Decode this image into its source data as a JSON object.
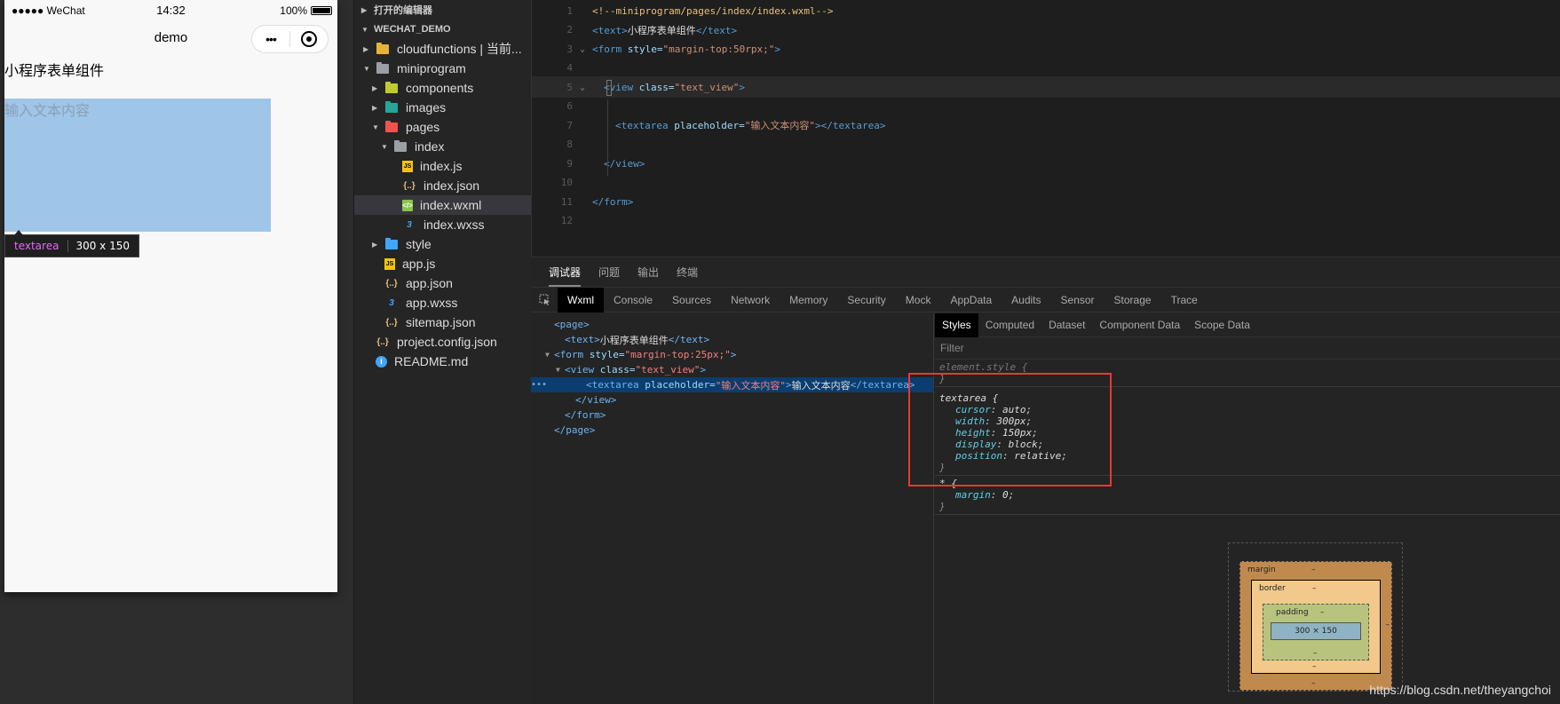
{
  "simulator": {
    "status": {
      "carrier": "●●●●● WeChat",
      "time": "14:32",
      "battery": "100%"
    },
    "nav_title": "demo",
    "capsule_more": "•••",
    "page_text": "小程序表单组件",
    "textarea_placeholder": "输入文本内容",
    "tooltip": {
      "tag": "textarea",
      "size": "300 x 150"
    }
  },
  "explorer": {
    "open_editors": "打开的编辑器",
    "project": "WECHAT_DEMO",
    "tree": [
      {
        "label": "cloudfunctions | 当前...",
        "depth": 1,
        "kind": "folder",
        "color": "#e5b33a",
        "tri": "▶"
      },
      {
        "label": "miniprogram",
        "depth": 1,
        "kind": "folder",
        "color": "#9aa0a6",
        "tri": "▼"
      },
      {
        "label": "components",
        "depth": 2,
        "kind": "folder",
        "color": "#c0ca33",
        "tri": "▶"
      },
      {
        "label": "images",
        "depth": 2,
        "kind": "folder",
        "color": "#26a69a",
        "tri": "▶"
      },
      {
        "label": "pages",
        "depth": 2,
        "kind": "folder",
        "color": "#ef5350",
        "tri": "▼"
      },
      {
        "label": "index",
        "depth": 3,
        "kind": "folder",
        "color": "#9aa0a6",
        "tri": "▼"
      },
      {
        "label": "index.js",
        "depth": 4,
        "kind": "js"
      },
      {
        "label": "index.json",
        "depth": 4,
        "kind": "json"
      },
      {
        "label": "index.wxml",
        "depth": 4,
        "kind": "wxml",
        "selected": true
      },
      {
        "label": "index.wxss",
        "depth": 4,
        "kind": "css"
      },
      {
        "label": "style",
        "depth": 2,
        "kind": "folder",
        "color": "#42a5f5",
        "tri": "▶"
      },
      {
        "label": "app.js",
        "depth": 2,
        "kind": "js"
      },
      {
        "label": "app.json",
        "depth": 2,
        "kind": "json"
      },
      {
        "label": "app.wxss",
        "depth": 2,
        "kind": "css"
      },
      {
        "label": "sitemap.json",
        "depth": 2,
        "kind": "json"
      },
      {
        "label": "project.config.json",
        "depth": 1,
        "kind": "json"
      },
      {
        "label": "README.md",
        "depth": 1,
        "kind": "info"
      }
    ]
  },
  "editor": {
    "lines": [
      {
        "n": "1",
        "fold": "",
        "indent": 0,
        "parts": [
          [
            "cm",
            "<!--miniprogram/pages/index/index.wxml-->"
          ]
        ]
      },
      {
        "n": "2",
        "fold": "",
        "indent": 0,
        "parts": [
          [
            "tg",
            "<text>"
          ],
          [
            "tx",
            "小程序表单组件"
          ],
          [
            "tg",
            "</text>"
          ]
        ]
      },
      {
        "n": "3",
        "fold": "⌄",
        "indent": 0,
        "parts": [
          [
            "tg",
            "<form "
          ],
          [
            "at",
            "style="
          ],
          [
            "st",
            "\"margin-top:50rpx;\""
          ],
          [
            "tg",
            ">"
          ]
        ]
      },
      {
        "n": "4",
        "fold": "",
        "indent": 0,
        "parts": []
      },
      {
        "n": "5",
        "fold": "⌄",
        "indent": 1,
        "hl": true,
        "parts": [
          [
            "tg",
            "<view "
          ],
          [
            "at",
            "class="
          ],
          [
            "st",
            "\"text_view\""
          ],
          [
            "tg",
            ">"
          ]
        ]
      },
      {
        "n": "6",
        "fold": "",
        "indent": 0,
        "parts": []
      },
      {
        "n": "7",
        "fold": "",
        "indent": 2,
        "parts": [
          [
            "tg",
            "<textarea "
          ],
          [
            "at",
            "placeholder="
          ],
          [
            "st",
            "\"输入文本内容\""
          ],
          [
            "tg",
            "></textarea>"
          ]
        ]
      },
      {
        "n": "8",
        "fold": "",
        "indent": 0,
        "parts": []
      },
      {
        "n": "9",
        "fold": "",
        "indent": 1,
        "parts": [
          [
            "tg",
            "</view>"
          ]
        ]
      },
      {
        "n": "10",
        "fold": "",
        "indent": 0,
        "parts": []
      },
      {
        "n": "11",
        "fold": "",
        "indent": 0,
        "parts": [
          [
            "tg",
            "</form>"
          ]
        ]
      },
      {
        "n": "12",
        "fold": "",
        "indent": 0,
        "parts": []
      }
    ]
  },
  "devtools": {
    "panel_tabs": [
      "调试器",
      "问题",
      "输出",
      "终端"
    ],
    "tabs": [
      "Wxml",
      "Console",
      "Sources",
      "Network",
      "Memory",
      "Security",
      "Mock",
      "AppData",
      "Audits",
      "Sensor",
      "Storage",
      "Trace"
    ],
    "wxml_lines": [
      {
        "indent": 0,
        "tri": "",
        "parts": [
          [
            "c-tag",
            "<page>"
          ]
        ]
      },
      {
        "indent": 1,
        "tri": "",
        "parts": [
          [
            "c-tag",
            "<text>"
          ],
          [
            "c-txt",
            "小程序表单组件"
          ],
          [
            "c-tag",
            "</text>"
          ]
        ]
      },
      {
        "indent": 0,
        "tri": "▼",
        "parts": [
          [
            "c-tag",
            "<form "
          ],
          [
            "c-att",
            "style="
          ],
          [
            "c-val",
            "\"margin-top:25px;\""
          ],
          [
            "c-tag",
            ">"
          ]
        ]
      },
      {
        "indent": 1,
        "tri": "▼",
        "parts": [
          [
            "c-tag",
            "<view "
          ],
          [
            "c-att",
            "class="
          ],
          [
            "c-val",
            "\"text_view\""
          ],
          [
            "c-tag",
            ">"
          ]
        ]
      },
      {
        "indent": 3,
        "tri": "",
        "sel": true,
        "parts": [
          [
            "c-tag",
            "<textarea "
          ],
          [
            "c-att",
            "placeholder="
          ],
          [
            "c-val",
            "\"输入文本内容\""
          ],
          [
            "c-tag",
            ">"
          ],
          [
            "c-txt",
            "输入文本内容"
          ],
          [
            "c-tag",
            "</textarea>"
          ]
        ]
      },
      {
        "indent": 2,
        "tri": "",
        "parts": [
          [
            "c-tag",
            "</view>"
          ]
        ]
      },
      {
        "indent": 1,
        "tri": "",
        "parts": [
          [
            "c-tag",
            "</form>"
          ]
        ]
      },
      {
        "indent": 0,
        "tri": "",
        "parts": [
          [
            "c-tag",
            "</page>"
          ]
        ]
      }
    ],
    "style_tabs": [
      "Styles",
      "Computed",
      "Dataset",
      "Component Data",
      "Scope Data"
    ],
    "filter_placeholder": "Filter",
    "rules": [
      {
        "selector": "element.style {",
        "decls": [],
        "close": "}"
      },
      {
        "selector": "textarea {",
        "decls": [
          [
            "cursor",
            "auto"
          ],
          [
            "width",
            "300px"
          ],
          [
            "height",
            "150px"
          ],
          [
            "display",
            "block"
          ],
          [
            "position",
            "relative"
          ]
        ],
        "close": "}"
      },
      {
        "selector": "* {",
        "decls": [
          [
            "margin",
            "0"
          ]
        ],
        "close": "}"
      }
    ],
    "boxmodel": {
      "margin": "margin",
      "border": "border",
      "padding": "padding",
      "content": "300 × 150",
      "dash": "–"
    }
  },
  "watermark": "https://blog.csdn.net/theyangchoi"
}
